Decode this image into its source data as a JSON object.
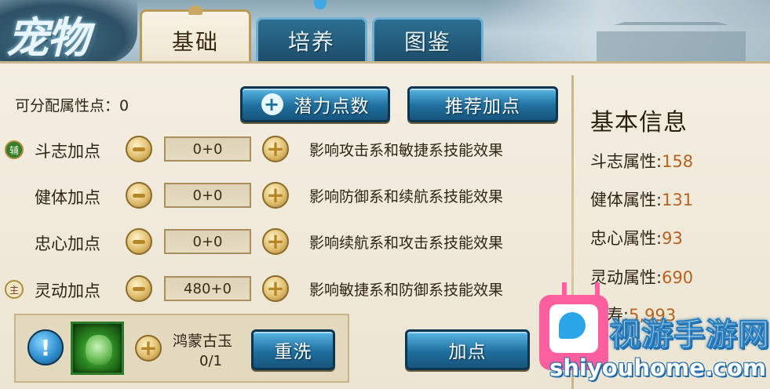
{
  "header": {
    "title": "宠物"
  },
  "tabs": [
    {
      "label": "基础",
      "active": true
    },
    {
      "label": "培养",
      "active": false
    },
    {
      "label": "图鉴",
      "active": false
    }
  ],
  "points": {
    "label": "可分配属性点：0"
  },
  "buttons": {
    "potential_label": "潜力点数",
    "recommend_label": "推荐加点",
    "rewash_label": "重洗",
    "add_point_label": "加点"
  },
  "attributes": [
    {
      "tag": "辅",
      "label": "斗志加点",
      "value": "0+0",
      "effect": "影响攻击系和敏捷系技能效果"
    },
    {
      "tag": "",
      "label": "健体加点",
      "value": "0+0",
      "effect": "影响防御系和续航系技能效果"
    },
    {
      "tag": "",
      "label": "忠心加点",
      "value": "0+0",
      "effect": "影响续航系和攻击系技能效果"
    },
    {
      "tag": "主",
      "label": "灵动加点",
      "value": "480+0",
      "effect": "影响敏捷系和防御系技能效果"
    }
  ],
  "item": {
    "name": "鸿蒙古玉",
    "count": "0/1",
    "info_glyph": "!"
  },
  "info_panel": {
    "title": "基本信息",
    "stats": [
      {
        "label": "斗志属性:",
        "value": "158"
      },
      {
        "label": "健体属性:",
        "value": "131"
      },
      {
        "label": "忠心属性:",
        "value": "93"
      },
      {
        "label": "灵动属性:",
        "value": "690"
      },
      {
        "label": "长寿:",
        "value": "5,993"
      }
    ]
  },
  "watermark": {
    "title": "视游手游网",
    "url": "shiyouhome.com"
  },
  "colors": {
    "panel_bg": "#f3eee1",
    "button_blue": "#1f6f9e",
    "stat_value": "#b9621d",
    "watermark_pink": "#ff5f9e"
  }
}
